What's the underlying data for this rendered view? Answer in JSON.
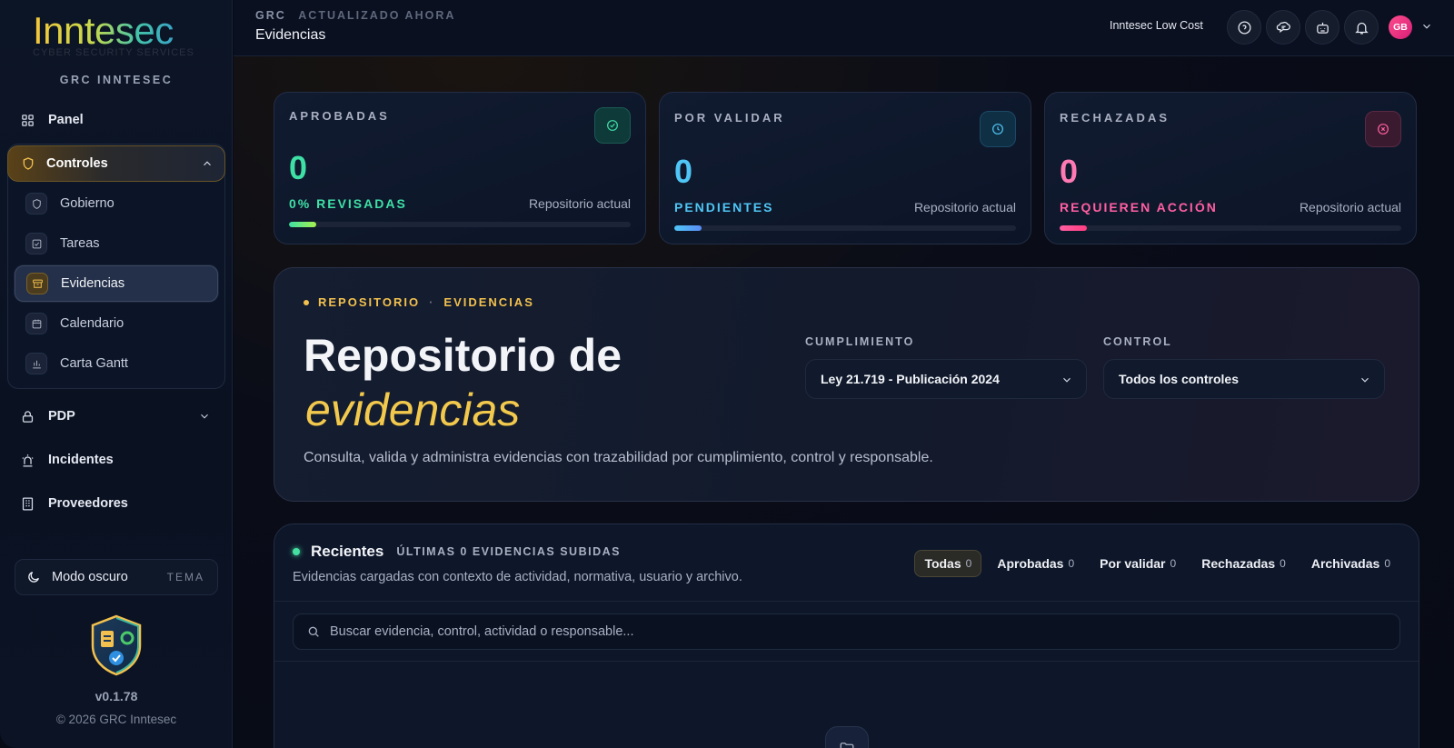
{
  "sidebar": {
    "logo_text": "Inntesec",
    "logo_sub": "CYBER SECURITY SERVICES",
    "brand": "GRC INNTESEC",
    "items": [
      {
        "label": "Panel",
        "icon": "grid-icon"
      },
      {
        "label": "PDP",
        "icon": "lock-icon"
      },
      {
        "label": "Incidentes",
        "icon": "siren-icon"
      },
      {
        "label": "Proveedores",
        "icon": "building-icon"
      }
    ],
    "group": {
      "label": "Controles",
      "icon": "shield-icon",
      "children": [
        {
          "label": "Gobierno",
          "icon": "shield-icon"
        },
        {
          "label": "Tareas",
          "icon": "checkbox-icon"
        },
        {
          "label": "Evidencias",
          "icon": "archive-icon",
          "active": true
        },
        {
          "label": "Calendario",
          "icon": "calendar-icon"
        },
        {
          "label": "Carta Gantt",
          "icon": "bar-chart-icon"
        }
      ]
    },
    "theme": {
      "label": "Modo oscuro",
      "tag": "TEMA"
    },
    "version": "v0.1.78",
    "copyright": "© 2026 GRC Inntesec"
  },
  "header": {
    "app": "GRC",
    "status": "ACTUALIZADO AHORA",
    "title": "Evidencias",
    "org": "Inntesec Low Cost",
    "avatar": "GB"
  },
  "stats": [
    {
      "label": "APROBADAS",
      "value": "0",
      "sub": "0% REVISADAS",
      "repo": "Repositorio actual",
      "color": "#3ee0a6",
      "progress": 0.08
    },
    {
      "label": "POR VALIDAR",
      "value": "0",
      "sub": "PENDIENTES",
      "repo": "Repositorio actual",
      "color": "#4fc6f5",
      "progress": 0.08
    },
    {
      "label": "RECHAZADAS",
      "value": "0",
      "sub": "REQUIEREN ACCIÓN",
      "repo": "Repositorio actual",
      "color": "#ff5fa2",
      "progress": 0.08
    }
  ],
  "hero": {
    "tag1": "REPOSITORIO",
    "tag2": "EVIDENCIAS",
    "title": "Repositorio de",
    "title_italic": "evidencias",
    "description": "Consulta, valida y administra evidencias con trazabilidad por cumplimiento, control y responsable.",
    "filters": [
      {
        "label": "CUMPLIMIENTO",
        "value": "Ley 21.719 - Publicación 2024"
      },
      {
        "label": "CONTROL",
        "value": "Todos los controles"
      }
    ]
  },
  "recent": {
    "title": "Recientes",
    "subtitle": "ÚLTIMAS 0 EVIDENCIAS SUBIDAS",
    "description": "Evidencias cargadas con contexto de actividad, normativa, usuario y archivo.",
    "tabs": [
      {
        "label": "Todas",
        "count": "0",
        "active": true
      },
      {
        "label": "Aprobadas",
        "count": "0"
      },
      {
        "label": "Por validar",
        "count": "0"
      },
      {
        "label": "Rechazadas",
        "count": "0"
      },
      {
        "label": "Archivadas",
        "count": "0"
      }
    ],
    "search_placeholder": "Buscar evidencia, control, actividad o responsable..."
  }
}
